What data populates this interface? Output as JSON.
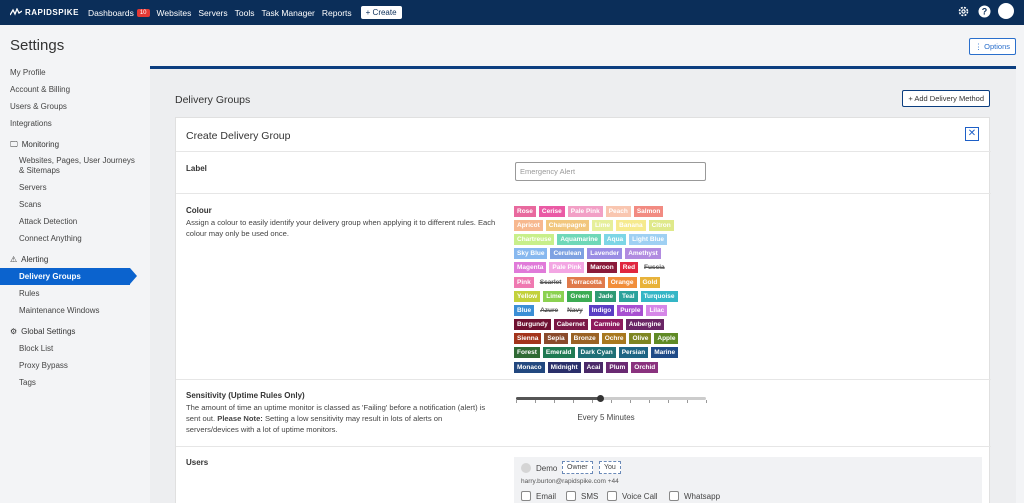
{
  "brand": "RAPIDSPIKE",
  "nav": {
    "dashboards": "Dashboards",
    "dashboards_badge": "10",
    "websites": "Websites",
    "servers": "Servers",
    "tools": "Tools",
    "task_manager": "Task Manager",
    "reports": "Reports",
    "create": "+ Create"
  },
  "page_title": "Settings",
  "options_label": "⋮ Options",
  "sidebar": {
    "top": [
      "My Profile",
      "Account & Billing",
      "Users & Groups",
      "Integrations"
    ],
    "monitoring": {
      "title": "Monitoring",
      "items": [
        "Websites, Pages, User Journeys & Sitemaps",
        "Servers",
        "Scans",
        "Attack Detection",
        "Connect Anything"
      ]
    },
    "alerting": {
      "title": "Alerting",
      "items": [
        "Delivery Groups",
        "Rules",
        "Maintenance Windows"
      ]
    },
    "global": {
      "title": "Global Settings",
      "items": [
        "Block List",
        "Proxy Bypass",
        "Tags"
      ]
    }
  },
  "section_title": "Delivery Groups",
  "add_button": "+ Add Delivery Method",
  "card_title": "Create Delivery Group",
  "close_label": "✕",
  "label_row": {
    "label": "Label",
    "placeholder": "Emergency Alert"
  },
  "colour_row": {
    "label": "Colour",
    "desc": "Assign a colour to easily identify your delivery group when applying it to different rules. Each colour may only be used once."
  },
  "colours": [
    [
      [
        "Rose",
        "#e8699e"
      ],
      [
        "Cerise",
        "#ea5aa5"
      ],
      [
        "Pale Pink",
        "#f2a0c6"
      ],
      [
        "Peach",
        "#f9c6b0"
      ],
      [
        "Salmon",
        "#f28b82"
      ]
    ],
    [
      [
        "Apricot",
        "#f7b88f"
      ],
      [
        "Champagne",
        "#f2c77e"
      ],
      [
        "Lime",
        "#e6ef9a"
      ],
      [
        "Banana",
        "#f6ea8e"
      ],
      [
        "Citron",
        "#dfe98a"
      ]
    ],
    [
      [
        "Chartreuse",
        "#c8ef8a"
      ],
      [
        "Aquamarine",
        "#6fd8b8"
      ],
      [
        "Aqua",
        "#7dd6e6"
      ],
      [
        "Light Blue",
        "#9fd0f3"
      ]
    ],
    [
      [
        "Sky Blue",
        "#87b8ef"
      ],
      [
        "Cerulean",
        "#7ea1e2"
      ],
      [
        "Lavender",
        "#9a8de4"
      ],
      [
        "Amethyst",
        "#b18be0"
      ]
    ],
    [
      [
        "Magenta",
        "#e07ad9"
      ],
      [
        "Pale Pink",
        "#f3a6e3"
      ],
      [
        "Maroon",
        "#8b1a3a"
      ],
      [
        "Red",
        "#e0263f"
      ],
      [
        "Fuscia",
        "strike"
      ]
    ],
    [
      [
        "Pink",
        "#ef79b1"
      ],
      [
        "Scarlet",
        "strike"
      ],
      [
        "Terracotta",
        "#e07a4b"
      ],
      [
        "Orange",
        "#f18e3b"
      ],
      [
        "Gold",
        "#e8b33b"
      ]
    ],
    [
      [
        "Yellow",
        "#c3d13c"
      ],
      [
        "Lime",
        "#8bd151"
      ],
      [
        "Green",
        "#3bab53"
      ],
      [
        "Jade",
        "#2f9a74"
      ],
      [
        "Teal",
        "#2ba29c"
      ],
      [
        "Turquoise",
        "#35b6c6"
      ]
    ],
    [
      [
        "Blue",
        "#3b8fd6"
      ],
      [
        "Azure",
        "strike"
      ],
      [
        "Navy",
        "strike"
      ],
      [
        "Indigo",
        "#5b3ec4"
      ],
      [
        "Purple",
        "#a84fd1"
      ],
      [
        "Lilac",
        "#d687e8"
      ]
    ],
    [
      [
        "Burgundy",
        "#6e1030"
      ],
      [
        "Cabernet",
        "#7a1946"
      ],
      [
        "Carmine",
        "#8e1a5e"
      ],
      [
        "Aubergine",
        "#6a2565"
      ]
    ],
    [
      [
        "Sienna",
        "#a3341b"
      ],
      [
        "Sepia",
        "#8a4b2c"
      ],
      [
        "Bronze",
        "#9a6224"
      ],
      [
        "Ochre",
        "#a8781e"
      ],
      [
        "Olive",
        "#7e8621"
      ],
      [
        "Apple",
        "#5f8a25"
      ]
    ],
    [
      [
        "Forest",
        "#2f6a34"
      ],
      [
        "Emerald",
        "#1f7a52"
      ],
      [
        "Dark Cyan",
        "#1f6f76"
      ],
      [
        "Persian",
        "#1e6584"
      ],
      [
        "Marine",
        "#1f4b88"
      ]
    ],
    [
      [
        "Monaco",
        "#22487f"
      ],
      [
        "Midnight",
        "#2a2f6a"
      ],
      [
        "Acai",
        "#4a2968"
      ],
      [
        "Plum",
        "#6a2a72"
      ],
      [
        "Orchid",
        "#8a327e"
      ]
    ]
  ],
  "sensitivity": {
    "label": "Sensitivity (Uptime Rules Only)",
    "desc_prefix": "The amount of time an uptime monitor is classed as 'Failing' before a notification (alert) is sent out. ",
    "desc_bold": "Please Note:",
    "desc_suffix": " Setting a low sensitivity may result in lots of alerts on servers/devices with a lot of uptime monitors.",
    "value_label": "Every 5 Minutes",
    "position_fraction": 0.44
  },
  "users": {
    "label": "Users",
    "name": "Demo",
    "tag_owner": "Owner",
    "tag_you": "You",
    "email": "harry.burton@rapidspike.com +44",
    "options": [
      "Email",
      "SMS",
      "Voice Call",
      "Whatsapp"
    ]
  }
}
